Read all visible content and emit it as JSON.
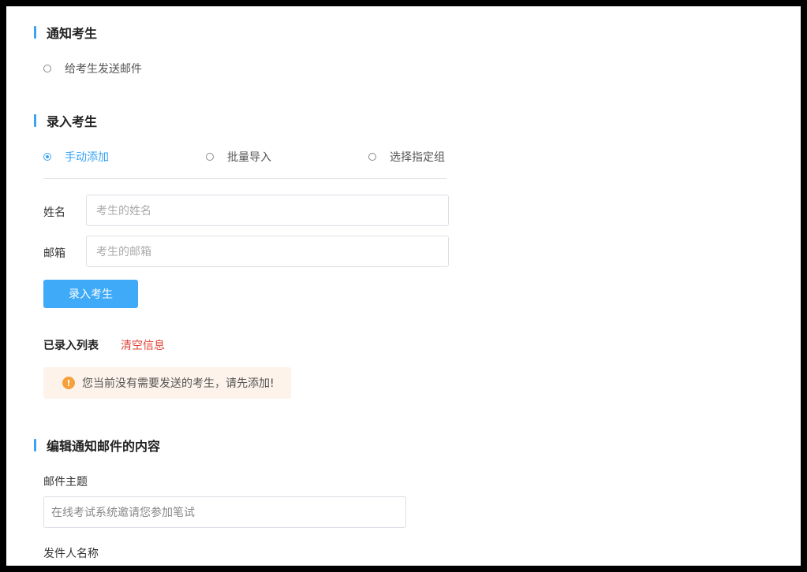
{
  "notify": {
    "title": "通知考生",
    "option_email": "给考生发送邮件"
  },
  "enter": {
    "title": "录入考生",
    "modes": [
      {
        "label": "手动添加",
        "checked": true
      },
      {
        "label": "批量导入",
        "checked": false
      },
      {
        "label": "选择指定组",
        "checked": false
      }
    ],
    "name_label": "姓名",
    "name_placeholder": "考生的姓名",
    "email_label": "邮箱",
    "email_placeholder": "考生的邮箱",
    "submit_label": "录入考生",
    "list_label": "已录入列表",
    "clear_label": "清空信息",
    "empty_notice": "您当前没有需要发送的考生，请先添加!"
  },
  "mail": {
    "title": "编辑通知邮件的内容",
    "subject_label": "邮件主题",
    "subject_value": "在线考试系统邀请您参加笔试",
    "sender_label": "发件人名称"
  },
  "colors": {
    "accent": "#3aa3f5",
    "danger": "#e0443a",
    "warning": "#f5a03a",
    "warning_bg": "#fdf3ea"
  }
}
